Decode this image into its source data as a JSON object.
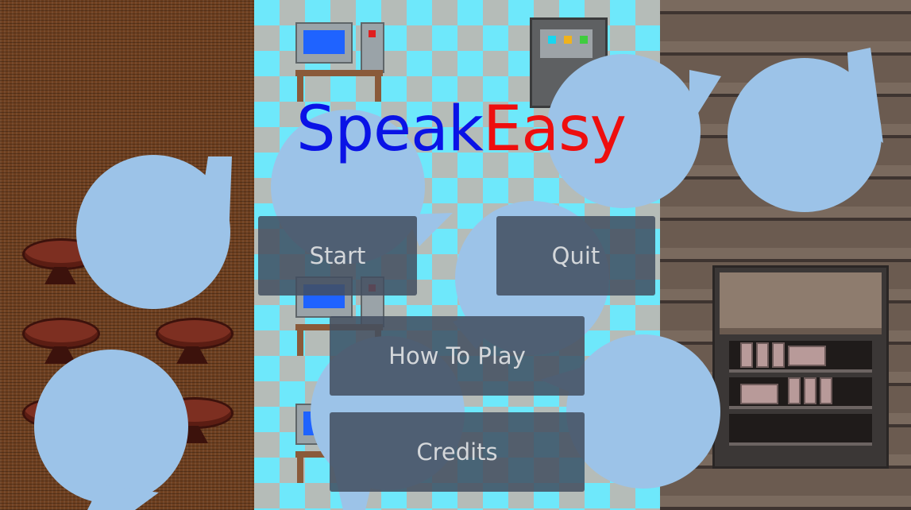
{
  "game": {
    "title_part1": "Speak",
    "title_part2": "Easy",
    "title_colors": {
      "part1": "#0a13e6",
      "part2": "#ee0e0e"
    }
  },
  "menu": {
    "start_label": "Start",
    "quit_label": "Quit",
    "how_to_play_label": "How To Play",
    "credits_label": "Credits"
  },
  "colors": {
    "bubble": "#9cc3e8",
    "button_bg": "#424e5f",
    "button_text": "#d4d7da"
  },
  "scenes": {
    "left": "bar-tables",
    "middle": "office-computers",
    "right": "wooden-storage"
  }
}
